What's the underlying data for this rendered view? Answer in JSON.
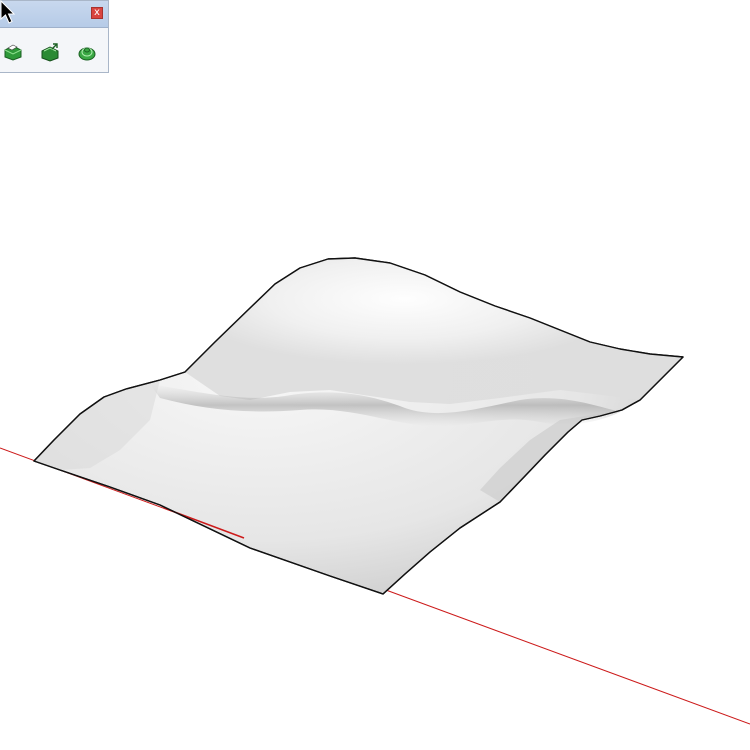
{
  "toolbar": {
    "title": "",
    "close_label": "x",
    "tools": [
      {
        "icon": "sandbox-from-contours-icon"
      },
      {
        "icon": "sandbox-from-scratch-icon"
      },
      {
        "icon": "sandbox-smoove-icon"
      }
    ]
  },
  "scene": {
    "axis_colors": {
      "red": "#cc1a1a"
    },
    "terrain_edge_color": "#111111"
  }
}
